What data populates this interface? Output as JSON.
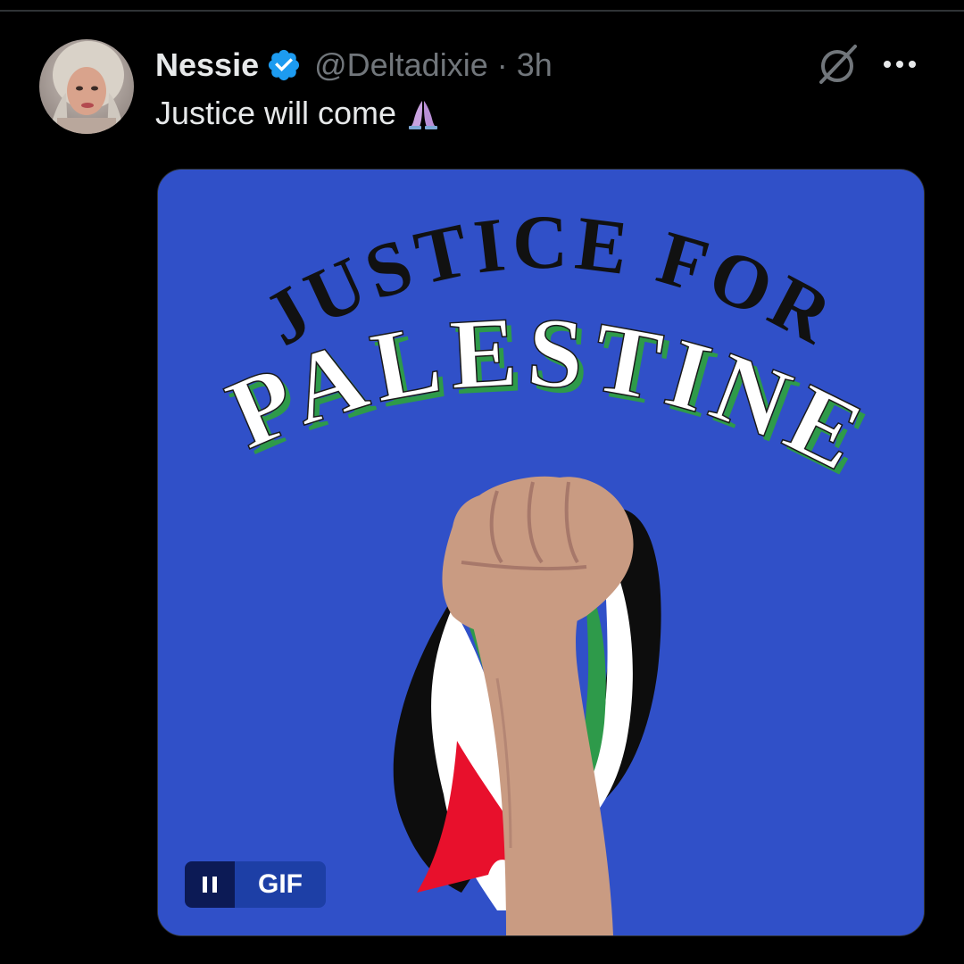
{
  "tweet": {
    "author": {
      "display_name": "Nessie",
      "handle": "@Deltadixie",
      "verified": true
    },
    "separator": "·",
    "time": "3h",
    "text": "Justice will come",
    "emoji": "folded-hands"
  },
  "media": {
    "type": "GIF",
    "badge_label": "GIF",
    "headline_top": "JUSTICE FOR",
    "headline_bottom": "PALESTINE",
    "colors": {
      "background": "#3050c8",
      "flag_black": "#0d0d0d",
      "flag_white": "#ffffff",
      "flag_green": "#2e9a4a",
      "flag_red": "#e8102c",
      "skin": "#c99b82"
    }
  },
  "colors": {
    "background": "#000000",
    "text_primary": "#e7e9ea",
    "text_secondary": "#71767b",
    "verified_blue": "#1d9bf0"
  }
}
